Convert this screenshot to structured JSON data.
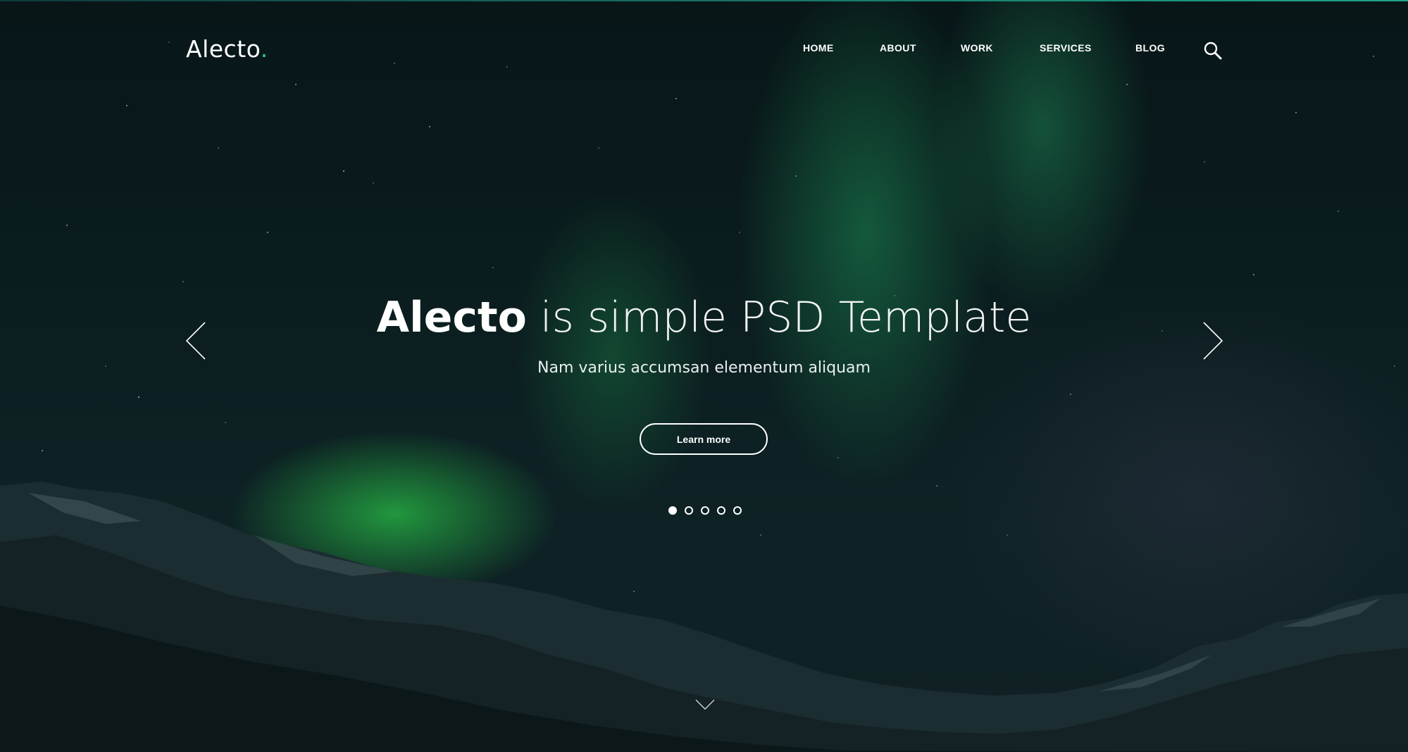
{
  "brand": {
    "name": "Alecto",
    "dot": ".",
    "accent_color": "#1fc9a1"
  },
  "nav": {
    "items": [
      {
        "label": "HOME"
      },
      {
        "label": "ABOUT"
      },
      {
        "label": "WORK"
      },
      {
        "label": "SERVICES"
      },
      {
        "label": "BLOG"
      }
    ],
    "search_icon": "search-icon"
  },
  "hero": {
    "title_strong": "Alecto",
    "title_light": " is simple PSD Template",
    "subtitle": "Nam varius accumsan elementum aliquam",
    "cta_label": "Learn more",
    "slides_total": 5,
    "active_slide": 1,
    "prev_icon": "chevron-left-icon",
    "next_icon": "chevron-right-icon",
    "scroll_icon": "chevron-down-icon"
  },
  "colors": {
    "text": "#ffffff",
    "background_dark": "#081618",
    "aurora_green": "#2fbf5a"
  }
}
